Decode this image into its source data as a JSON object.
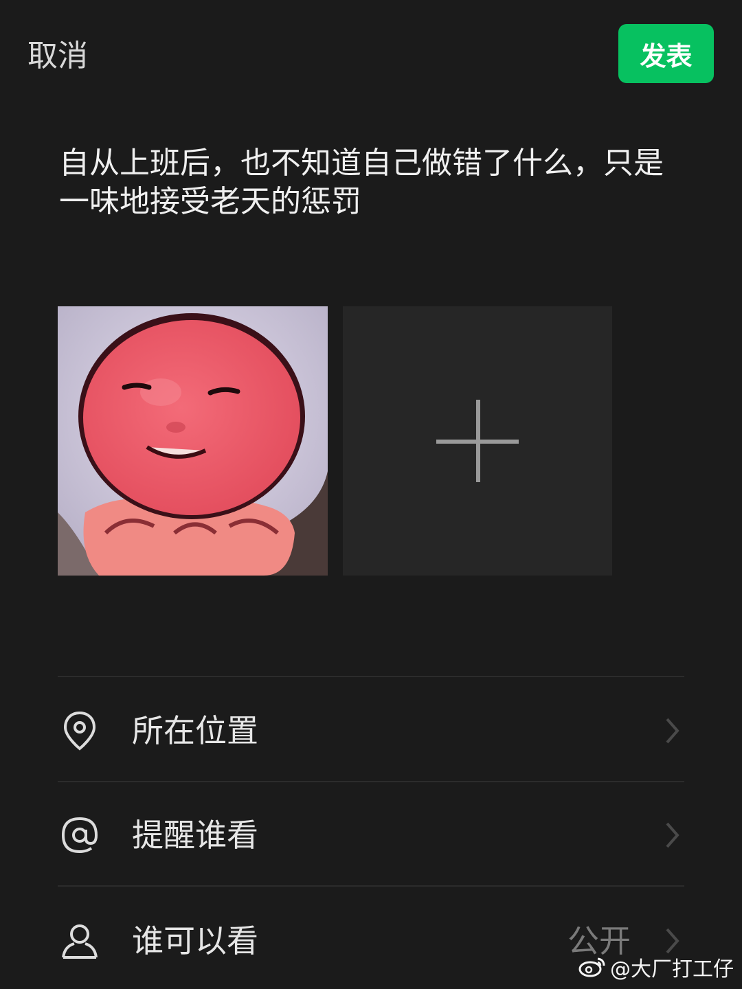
{
  "header": {
    "cancel_label": "取消",
    "publish_label": "发表"
  },
  "post": {
    "text": "自从上班后，也不知道自己做错了什么，只是一味地接受老天的惩罚"
  },
  "media": {
    "add_icon": "plus-icon"
  },
  "options": [
    {
      "label": "所在位置",
      "icon": "location-pin-icon",
      "value": ""
    },
    {
      "label": "提醒谁看",
      "icon": "at-sign-icon",
      "value": ""
    },
    {
      "label": "谁可以看",
      "icon": "person-icon",
      "value": "公开"
    }
  ],
  "watermark": {
    "text": "@大厂打工仔",
    "icon": "weibo-logo-icon"
  },
  "colors": {
    "background": "#1b1b1b",
    "accent": "#07c160",
    "tile": "#262626"
  }
}
